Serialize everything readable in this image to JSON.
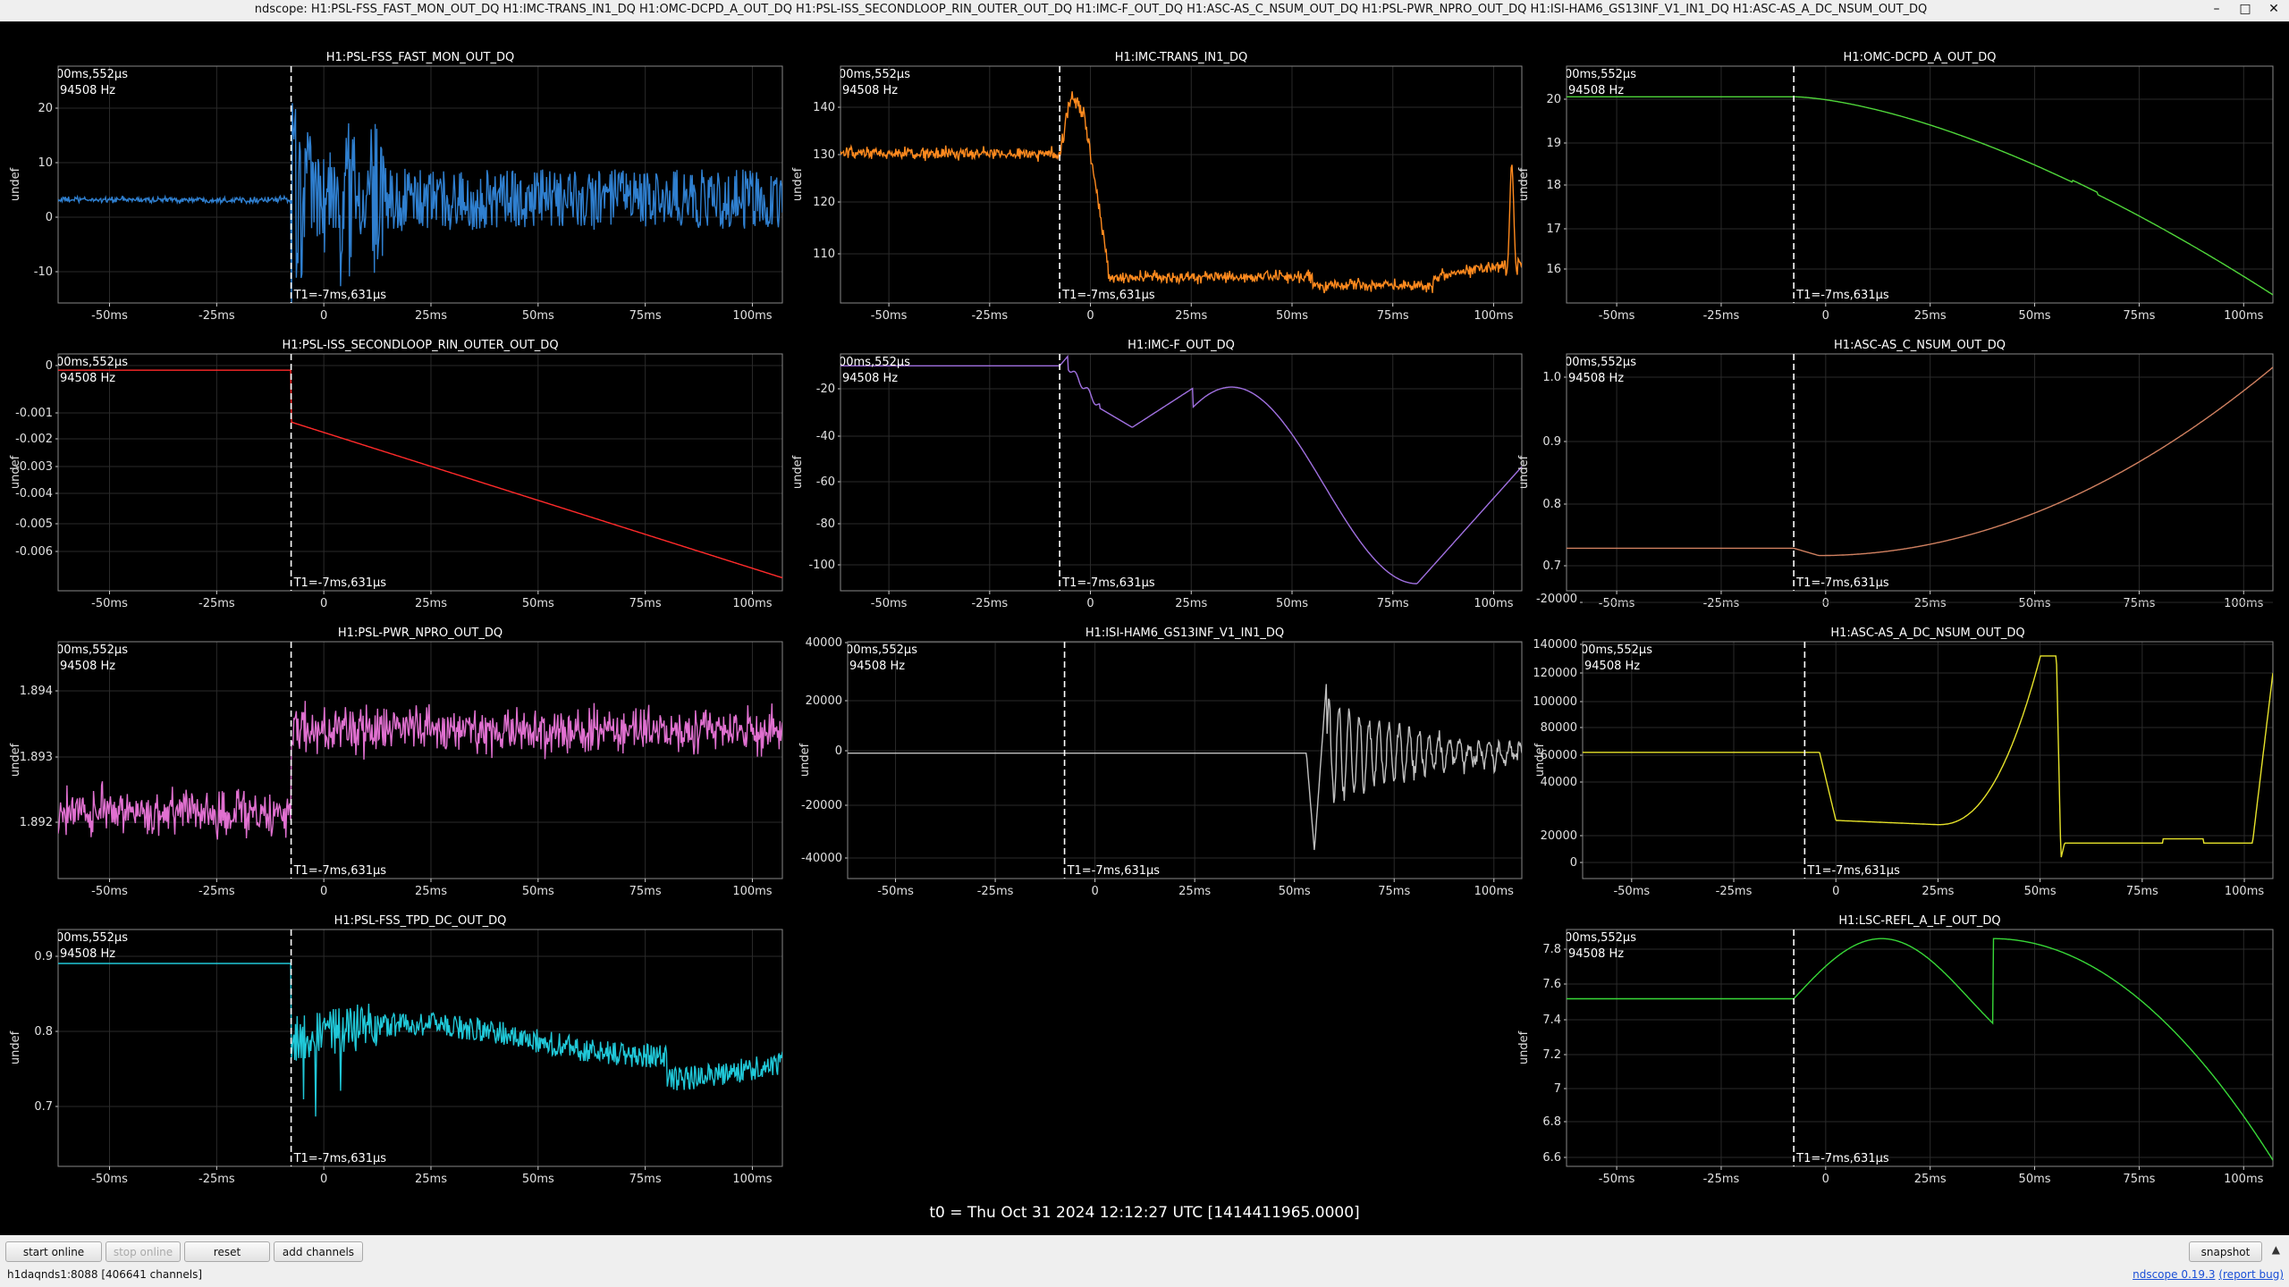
{
  "window": {
    "title": "ndscope: H1:PSL-FSS_FAST_MON_OUT_DQ H1:IMC-TRANS_IN1_DQ H1:OMC-DCPD_A_OUT_DQ H1:PSL-ISS_SECONDLOOP_RIN_OUTER_OUT_DQ H1:IMC-F_OUT_DQ H1:ASC-AS_C_NSUM_OUT_DQ H1:PSL-PWR_NPRO_OUT_DQ H1:ISI-HAM6_GS13INF_V1_IN1_DQ H1:ASC-AS_A_DC_NSUM_OUT_DQ",
    "controls": [
      "–",
      "□",
      "✕"
    ]
  },
  "x_ticks": [
    "-50ms",
    "-25ms",
    "0",
    "25ms",
    "50ms",
    "75ms",
    "100ms"
  ],
  "cursor_info": {
    "t_label": "00ms,552µs",
    "f_label": "94508 Hz",
    "t1_label": "T1=-7ms,631µs"
  },
  "t0_label": "t0 = Thu Oct 31 2024 12:12:27 UTC [1414411965.0000]",
  "toolbar": {
    "start_online": "start online",
    "stop_online": "stop online",
    "reset": "reset",
    "add_channels": "add channels",
    "snapshot": "snapshot",
    "expand": "▲"
  },
  "status": {
    "server": "h1daqnds1:8088  [406641 channels]",
    "version_link": "ndscope 0.19.3",
    "report_link": "(report bug)"
  },
  "colors": {
    "fss_fast": "#2f7fcf",
    "imc_trans": "#ff8a1e",
    "omc_dcpd": "#4fd63a",
    "iss": "#ff2a2a",
    "imc_f": "#a070e0",
    "as_c": "#d08060",
    "npro": "#e070d0",
    "isi": "#c0c0c0",
    "as_a": "#e6e22a",
    "tpd": "#20c8d8",
    "lsc": "#38d838"
  },
  "chart_data": [
    {
      "type": "line",
      "title": "H1:PSL-FSS_FAST_MON_OUT_DQ",
      "ylabel": "undef",
      "yticks": [
        "20",
        "10",
        "0",
        "-10"
      ],
      "ylim": [
        -17,
        22
      ],
      "xlim": [
        -62,
        107
      ],
      "series": [
        {
          "color": "#2f7fcf",
          "shape": "noise",
          "baseline": 0,
          "pre_noise": 0.3,
          "post_envelope": "decaying bursts then steady ±5"
        }
      ]
    },
    {
      "type": "line",
      "title": "H1:IMC-TRANS_IN1_DQ",
      "ylabel": "undef",
      "yticks": [
        "140",
        "130",
        "120",
        "110"
      ],
      "ylim": [
        102,
        148
      ],
      "xlim": [
        -62,
        107
      ],
      "series": [
        {
          "color": "#ff8a1e",
          "pre_level": 131,
          "peak": 143,
          "post_level": 107,
          "late_spike": 130
        }
      ]
    },
    {
      "type": "line",
      "title": "H1:OMC-DCPD_A_OUT_DQ",
      "ylabel": "undef",
      "yticks": [
        "20",
        "19",
        "18",
        "17",
        "16"
      ],
      "ylim": [
        15.4,
        21.2
      ],
      "xlim": [
        -62,
        107
      ],
      "series": [
        {
          "color": "#4fd63a",
          "pre_level": 20.45,
          "end_level": 15.6
        }
      ]
    },
    {
      "type": "line",
      "title": "H1:PSL-ISS_SECONDLOOP_RIN_OUTER_OUT_DQ",
      "ylabel": "undef",
      "yticks": [
        "0",
        "-0.001",
        "-0.002",
        "-0.003",
        "-0.004",
        "-0.005",
        "-0.006"
      ],
      "ylim": [
        -0.0068,
        0.0005
      ],
      "xlim": [
        -62,
        107
      ],
      "series": [
        {
          "color": "#ff2a2a",
          "pre_level": 0,
          "post_start": -0.0016,
          "post_end": -0.0064
        }
      ]
    },
    {
      "type": "line",
      "title": "H1:IMC-F_OUT_DQ",
      "ylabel": "undef",
      "yticks": [
        "-20",
        "-40",
        "-60",
        "-80",
        "-100"
      ],
      "ylim": [
        -108,
        -8
      ],
      "xlim": [
        -62,
        107
      ],
      "series": [
        {
          "color": "#a070e0",
          "pre_level": -13,
          "local_max": -22,
          "min": -105,
          "end_level": -57
        }
      ]
    },
    {
      "type": "line",
      "title": "H1:ASC-AS_C_NSUM_OUT_DQ",
      "ylabel": "undef",
      "yticks": [
        "1.0",
        "0.9",
        "0.8",
        "0.7"
      ],
      "ylim": [
        0.67,
        1.06
      ],
      "xlim": [
        -62,
        107
      ],
      "series": [
        {
          "color": "#d08060",
          "pre_level": 0.74,
          "end_level": 1.04
        }
      ]
    },
    {
      "type": "line",
      "title": "H1:PSL-PWR_NPRO_OUT_DQ",
      "ylabel": "undef",
      "yticks": [
        "1.894",
        "1.893",
        "1.892"
      ],
      "ylim": [
        1.8913,
        1.8945
      ],
      "xlim": [
        -62,
        107
      ],
      "series": [
        {
          "color": "#e070d0",
          "pre_level": 1.8922,
          "post_level": 1.8933
        }
      ]
    },
    {
      "type": "line",
      "title": "H1:ISI-HAM6_GS13INF_V1_IN1_DQ",
      "ylabel": "undef",
      "yticks": [
        "40000",
        "20000",
        "0",
        "-20000",
        "-40000"
      ],
      "ylim": [
        -45000,
        40000
      ],
      "xlim": [
        -62,
        107
      ],
      "series": [
        {
          "color": "#c0c0c0",
          "pre_level": 0,
          "transient_start": 53,
          "max": 25000,
          "min": -35000
        }
      ]
    },
    {
      "type": "line",
      "title": "H1:ASC-AS_A_DC_NSUM_OUT_DQ",
      "ylabel": "undef",
      "yticks": [
        "140000",
        "120000",
        "100000",
        "80000",
        "60000",
        "40000",
        "20000",
        "0",
        "-20000"
      ],
      "ylim": [
        -25000,
        142000
      ],
      "xlim": [
        -62,
        107
      ],
      "series": [
        {
          "color": "#e6e22a",
          "pre_level": 64000,
          "peak": 132000,
          "post_level": 0
        }
      ]
    },
    {
      "type": "line",
      "title": "H1:PSL-FSS_TPD_DC_OUT_DQ",
      "ylabel": "undef",
      "yticks": [
        "0.9",
        "0.8",
        "0.7"
      ],
      "ylim": [
        0.62,
        0.92
      ],
      "xlim": [
        -62,
        107
      ],
      "series": [
        {
          "color": "#20c8d8",
          "pre_level": 0.877,
          "post_level": 0.76
        }
      ]
    },
    {
      "type": "line",
      "title": "H1:LSC-REFL_A_LF_OUT_DQ",
      "ylabel": "undef",
      "yticks": [
        "7.8",
        "7.6",
        "7.4",
        "7.2",
        "7",
        "6.8",
        "6.6"
      ],
      "ylim": [
        6.58,
        7.88
      ],
      "xlim": [
        -62,
        107
      ],
      "series": [
        {
          "color": "#38d838",
          "pre_level": 7.5,
          "peak": 7.83,
          "end_level": 6.65
        }
      ]
    }
  ]
}
